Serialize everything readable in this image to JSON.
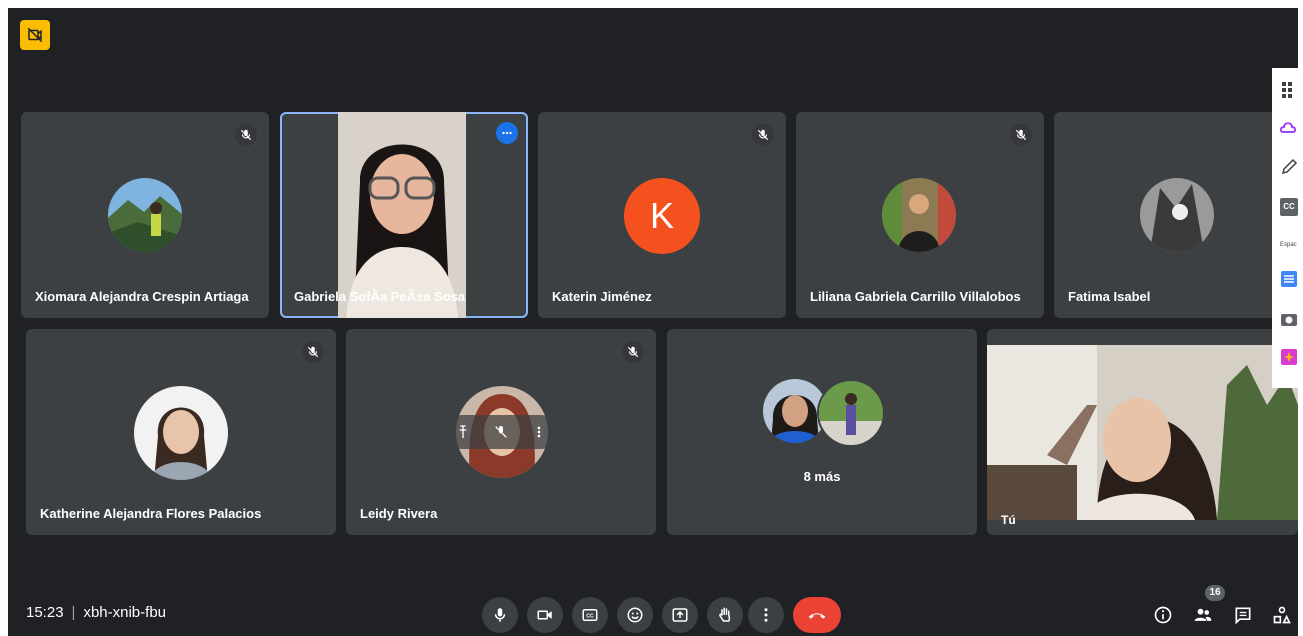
{
  "top_badge": {
    "icon": "camera-off-icon",
    "color": "#fbbc04"
  },
  "participants_row1": [
    {
      "name": "Xiomara Alejandra Crespin Artiaga",
      "muted": true
    },
    {
      "name": "Gabriela SofÃa PeÃ±a Sosa",
      "muted": false,
      "speaking": true
    },
    {
      "name": "Katerin Jiménez",
      "muted": true,
      "initial": "K",
      "avatar_color": "#f4511e"
    },
    {
      "name": "Liliana Gabriela Carrillo Villalobos",
      "muted": true
    },
    {
      "name": "Fatima Isabel",
      "muted": false
    }
  ],
  "participants_row2": [
    {
      "name": "Katherine Alejandra Flores Palacios",
      "muted": true
    },
    {
      "name": "Leidy Rivera",
      "muted": true
    },
    {
      "more_label": "8 más"
    },
    {
      "name": "Tú"
    }
  ],
  "bottom_bar": {
    "time": "15:23",
    "separator": "|",
    "meeting_code": "xbh-xnib-fbu",
    "participant_count": "16",
    "end_call_color": "#ea4335"
  },
  "side_panel": {
    "cc_label": "CC",
    "espacio_label": "Espac"
  }
}
